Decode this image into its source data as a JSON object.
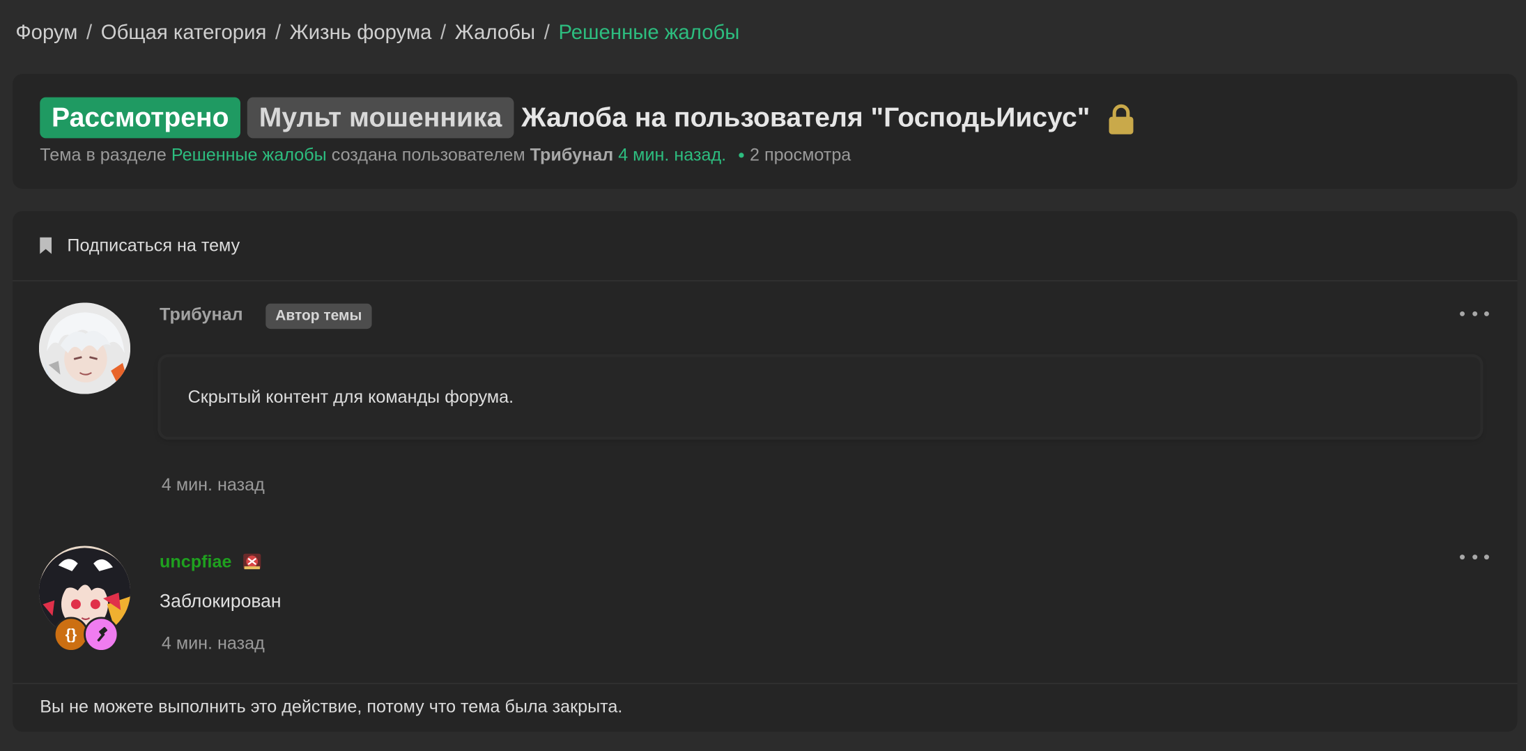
{
  "breadcrumb": {
    "items": [
      "Форум",
      "Общая категория",
      "Жизнь форума",
      "Жалобы",
      "Решенные жалобы"
    ],
    "separator": "/"
  },
  "thread": {
    "prefix_status": "Рассмотрено",
    "prefix_type": "Мульт мошенника",
    "title": "Жалоба на пользователя \"ГосподьИисус\"",
    "meta_text_1": "Тема в разделе",
    "section_link": "Решенные жалобы",
    "meta_text_2": "создана пользователем",
    "author": "Трибунал",
    "created_time": "4 мин. назад.",
    "views": "2 просмотра"
  },
  "subscribe_label": "Подписаться на тему",
  "posts": [
    {
      "username": "Трибунал",
      "tag": "Автор темы",
      "content": "Скрытый контент для команды форума.",
      "time": "4 мин. назад"
    },
    {
      "username": "uncpfiae",
      "content": "Заблокирован",
      "time": "4 мин. назад",
      "badge_1": "{}"
    }
  ],
  "closed_message": "Вы не можете выполнить это действие, потому что тема была закрыта.",
  "colors": {
    "accent_green": "#2dbd7f",
    "prefix_green": "#1f9a62",
    "username_green": "#1fa01f",
    "lock_gold": "#c9a94a",
    "background": "#2c2c2c",
    "card": "#252525"
  },
  "icons": {
    "lock": "lock-icon",
    "bookmark": "bookmark-icon",
    "more": "more-horizontal-icon",
    "username_flair": "emblem-icon",
    "badge_code": "code-braces-icon",
    "badge_hammer": "hammer-icon"
  }
}
